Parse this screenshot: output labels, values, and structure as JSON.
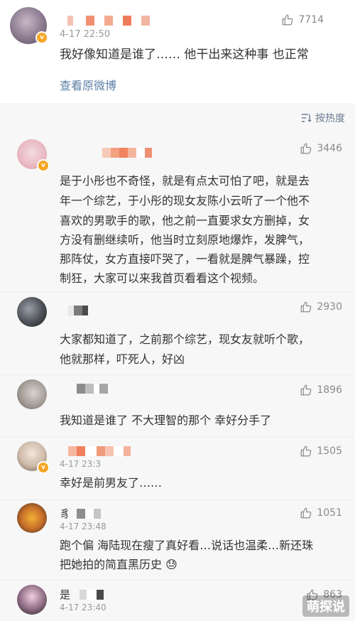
{
  "top_post": {
    "time": "4-17 22:50",
    "likes": "7714",
    "text": "我好像知道是谁了…… 他干出来这种事 也正常",
    "view_original": "查看原微博"
  },
  "sort": {
    "label": "按热度"
  },
  "comments": [
    {
      "likes": "3446",
      "time": "",
      "lines": [
        "是于小彤也不奇怪，就是有点太可怕了吧，就是去",
        "年一个综艺，于小彤的现女友陈小云听了一个他不",
        "喜欢的男歌手的歌，他之前一直要求女方删掉，女",
        "方没有删继续听，他当时立刻原地爆炸，发脾气，",
        "那阵仗，女方直接吓哭了，一看就是脾气暴躁，控",
        "制狂，大家可以来我首页看看这个视频。"
      ]
    },
    {
      "likes": "2930",
      "time": "",
      "lines": [
        "大家都知道了，之前那个综艺，现女友就听个歌，",
        "他就那样，吓死人，好凶"
      ]
    },
    {
      "likes": "1896",
      "time": "",
      "lines": [
        "我知道是谁了 不大理智的那个 幸好分手了"
      ]
    },
    {
      "likes": "1505",
      "time": "4-17 23:3",
      "lines": [
        "幸好是前男友了……"
      ]
    },
    {
      "likes": "1051",
      "time": "4-17 23:48",
      "name_prefix": "豸",
      "lines": [
        "跑个偏  海陆现在瘦了真好看…说话也温柔…新还珠",
        "把她拍的简直黑历史 😓"
      ]
    },
    {
      "likes": "863",
      "time": "4-17 23:40",
      "name_prefix": "是",
      "lines": []
    }
  ],
  "watermark": "萌探说",
  "colors": {
    "link": "#5b7fa6",
    "badge": "#f5a623",
    "like": "#8a8a8a"
  }
}
